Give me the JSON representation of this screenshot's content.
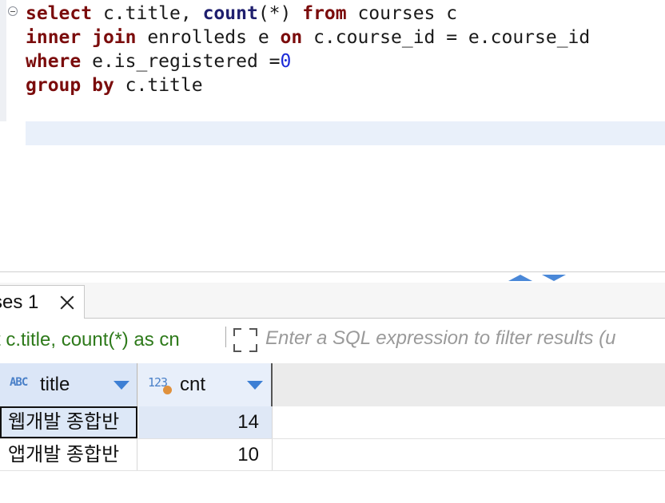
{
  "editor": {
    "lines": [
      [
        {
          "t": "select",
          "c": "kw"
        },
        {
          "t": " c.title, "
        },
        {
          "t": "count",
          "c": "fn"
        },
        {
          "t": "(*) "
        },
        {
          "t": "from",
          "c": "kw"
        },
        {
          "t": " courses c"
        }
      ],
      [
        {
          "t": "inner",
          "c": "kw"
        },
        {
          "t": " "
        },
        {
          "t": "join",
          "c": "kw"
        },
        {
          "t": " enrolleds e "
        },
        {
          "t": "on",
          "c": "kw"
        },
        {
          "t": " c.course_id = e.course_id"
        }
      ],
      [
        {
          "t": "where",
          "c": "kw"
        },
        {
          "t": " e.is_registered ="
        },
        {
          "t": "0",
          "c": "num"
        }
      ],
      [
        {
          "t": "group",
          "c": "kw"
        },
        {
          "t": " "
        },
        {
          "t": "by",
          "c": "kw"
        },
        {
          "t": " c.title"
        }
      ]
    ]
  },
  "results": {
    "tab_label": "ses 1",
    "query_text": "t c.title, count(*) as cn",
    "filter_placeholder": "Enter a SQL expression to filter results (u",
    "columns": [
      {
        "name": "title",
        "type_badge": "ABC"
      },
      {
        "name": "cnt",
        "type_badge": "123"
      }
    ],
    "rows": [
      {
        "title": "웹개발 종합반",
        "cnt": "14"
      },
      {
        "title": "앱개발 종합반",
        "cnt": "10"
      }
    ]
  },
  "colors": {
    "keyword": "#7b0c0c",
    "function": "#1f1f6e",
    "number": "#1b2ad8",
    "query_text": "#2e7a1b",
    "accent": "#3d7fd4"
  },
  "icons": {
    "fold": "fold-minus-icon",
    "close": "close-icon",
    "expand": "expand-icon",
    "sort": "sort-down-arrow-icon"
  }
}
